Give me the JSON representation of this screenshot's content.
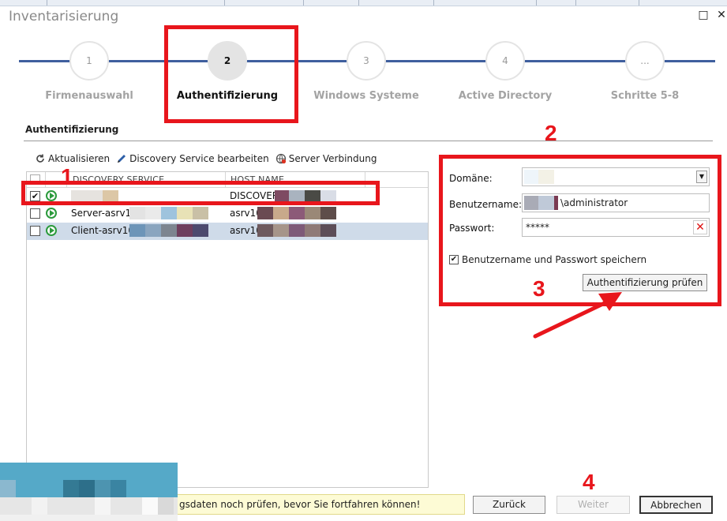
{
  "window": {
    "title": "Inventarisierung",
    "maximize_icon": "□",
    "close_icon": "✕"
  },
  "steps": [
    {
      "number": "1",
      "label": "Firmenauswahl",
      "active": false
    },
    {
      "number": "2",
      "label": "Authentifizierung",
      "active": true
    },
    {
      "number": "3",
      "label": "Windows Systeme",
      "active": false
    },
    {
      "number": "4",
      "label": "Active Directory",
      "active": false
    },
    {
      "number": "...",
      "label": "Schritte 5-8",
      "active": false
    }
  ],
  "section": {
    "title": "Authentifizierung"
  },
  "toolbar": {
    "refresh_label": "Aktualisieren",
    "edit_label": "Discovery Service bearbeiten",
    "connect_label": "Server Verbindung"
  },
  "grid": {
    "col_service": "DISCOVERY SERVICE",
    "col_host": "HOST NAME",
    "rows": [
      {
        "checked": "✔",
        "service": "",
        "host": "DISCOVERY"
      },
      {
        "checked": "",
        "service": "Server-asrv10.",
        "host": "asrv10."
      },
      {
        "checked": "",
        "service": "Client-asrv10.",
        "host": "asrv10."
      }
    ]
  },
  "auth": {
    "domain_label": "Domäne:",
    "domain_value": "",
    "user_label": "Benutzername:",
    "user_value": "\\administrator",
    "password_label": "Passwort:",
    "password_value": "*****",
    "save_label": "Benutzername und Passwort speichern",
    "save_checked": "✔",
    "check_button": "Authentifizierung prüfen"
  },
  "annotations": [
    "1",
    "2",
    "3",
    "4"
  ],
  "status": {
    "text": "gsdaten noch prüfen, bevor Sie fortfahren können!"
  },
  "buttons": {
    "back": "Zurück",
    "next": "Weiter",
    "cancel": "Abbrechen"
  },
  "colors": {
    "accent_line": "#3f5f9e",
    "annotation_red": "#e8161c",
    "status_bg": "#fdfbd5",
    "selected_row": "#cfdbe9"
  }
}
